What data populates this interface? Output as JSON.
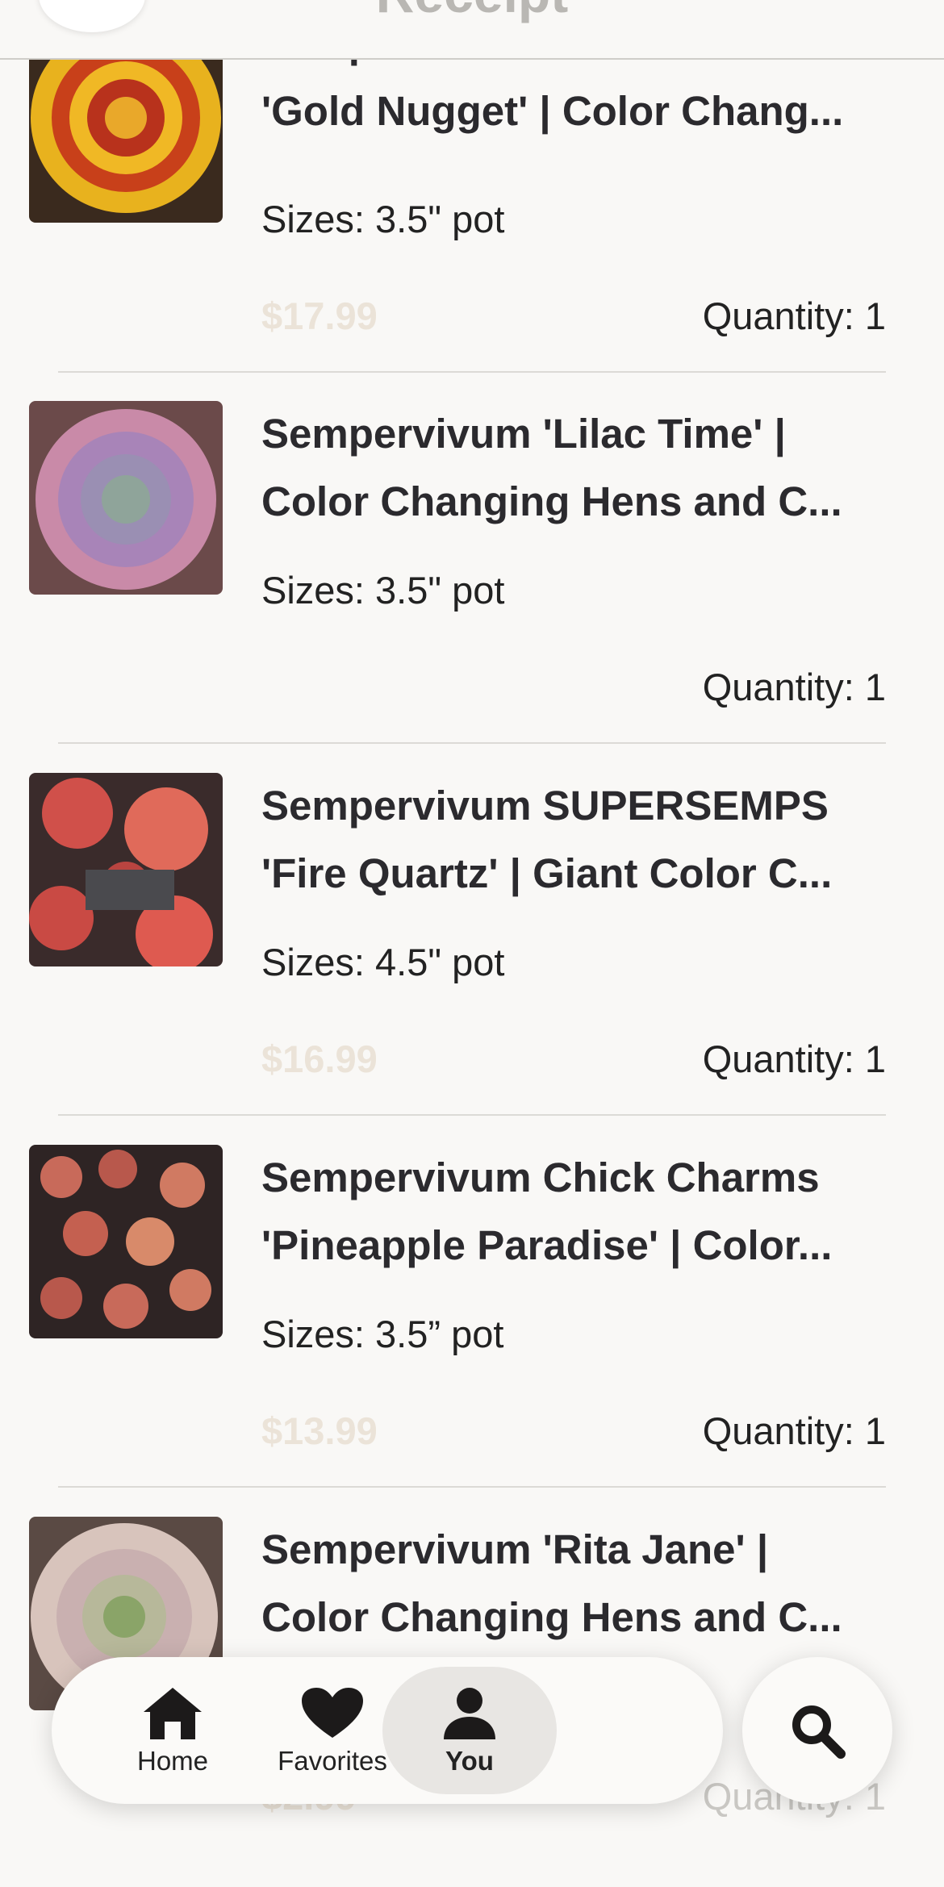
{
  "header": {
    "title": "Receipt"
  },
  "items": [
    {
      "title_lines": [
        "Sempervivum Chick Charms",
        "'Gold Nugget' | Color Chang..."
      ],
      "size": "Sizes: 3.5\" pot",
      "price": "$17.99",
      "quantity": "Quantity: 1"
    },
    {
      "title_lines": [
        "Sempervivum 'Lilac Time' |",
        "Color Changing Hens and C..."
      ],
      "size": "Sizes: 3.5\" pot",
      "price": "",
      "quantity": "Quantity: 1"
    },
    {
      "title_lines": [
        "Sempervivum SUPERSEMPS",
        "'Fire Quartz' | Giant Color C..."
      ],
      "size": "Sizes: 4.5\" pot",
      "price": "$16.99",
      "quantity": "Quantity: 1"
    },
    {
      "title_lines": [
        "Sempervivum Chick Charms",
        "'Pineapple Paradise' | Color..."
      ],
      "size": "Sizes: 3.5” pot",
      "price": "$13.99",
      "quantity": "Quantity: 1"
    },
    {
      "title_lines": [
        "Sempervivum 'Rita Jane' |",
        "Color Changing Hens and C..."
      ],
      "size": "",
      "price": "$2.99",
      "quantity": "Quantity: 1"
    }
  ],
  "nav": {
    "home": "Home",
    "favorites": "Favorites",
    "you": "You",
    "active": "you"
  },
  "icons": {
    "back": "back-arrow-icon",
    "home": "home-icon",
    "favorites": "heart-icon",
    "you": "person-icon",
    "search": "search-icon"
  }
}
